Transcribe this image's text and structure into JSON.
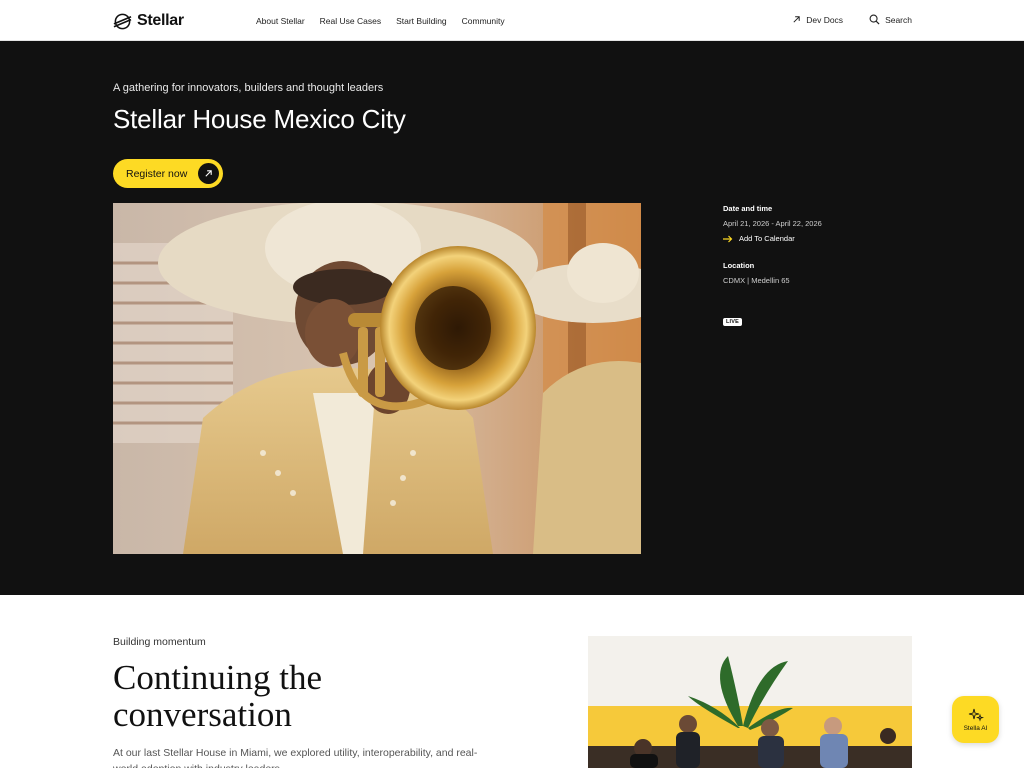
{
  "nav": {
    "logo_text": "Stellar",
    "links": [
      "About Stellar",
      "Real Use Cases",
      "Start Building",
      "Community"
    ],
    "dev_docs": "Dev Docs",
    "search": "Search"
  },
  "hero": {
    "tagline": "A gathering for innovators, builders and thought leaders",
    "title": "Stellar House Mexico City",
    "register_label": "Register now",
    "photo_icon": "mariachi-trumpet-photo",
    "details": {
      "date_heading": "Date and time",
      "date_value": "April 21, 2026 - April 22, 2026",
      "calendar_link": "Add To Calendar",
      "location_heading": "Location",
      "location_value": "CDMX | Medellin 65",
      "live_badge": "LIVE"
    }
  },
  "section2": {
    "eyebrow": "Building momentum",
    "title": "Continuing the conversation",
    "body": "At our last Stellar House in Miami, we explored utility, interoperability, and real-world adoption with industry leaders.",
    "photo_icon": "panel-discussion-photo"
  },
  "stella_ai": {
    "label": "Stella AI"
  },
  "colors": {
    "accent_yellow": "#fdda24",
    "hero_bg": "#111111"
  }
}
